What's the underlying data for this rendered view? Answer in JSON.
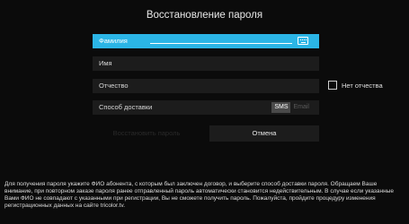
{
  "title": "Восстановление пароля",
  "fields": {
    "surname": {
      "label": "Фамилия",
      "value": ""
    },
    "name": {
      "label": "Имя",
      "value": ""
    },
    "patronymic": {
      "label": "Отчество",
      "value": ""
    },
    "delivery": {
      "label": "Способ доставки",
      "options": [
        "SMS",
        "Email"
      ],
      "selected": "SMS"
    }
  },
  "no_patronymic": {
    "label": "Нет отчества",
    "checked": false
  },
  "buttons": {
    "restore": "Восстановить пароль",
    "cancel": "Отмена"
  },
  "info_text": "Для получения пароля укажите ФИО абонента, с которым был заключен договор, и выберите способ доставки пароля. Обращаем Ваше внимание, при повторном заказе пароля ранее отправленный пароль автоматически становится недействительным. В случае если указанные Вами ФИО не совпадают с указанными при регистрации, Вы не сможете получить пароль. Пожалуйста, пройдите процедуру изменения регистрационных данных на сайте tricolor.tv.",
  "icons": {
    "keyboard": "keyboard-icon"
  },
  "colors": {
    "accent": "#2bb5e6",
    "background": "#0b0b0b",
    "field": "#1c1c1c"
  }
}
